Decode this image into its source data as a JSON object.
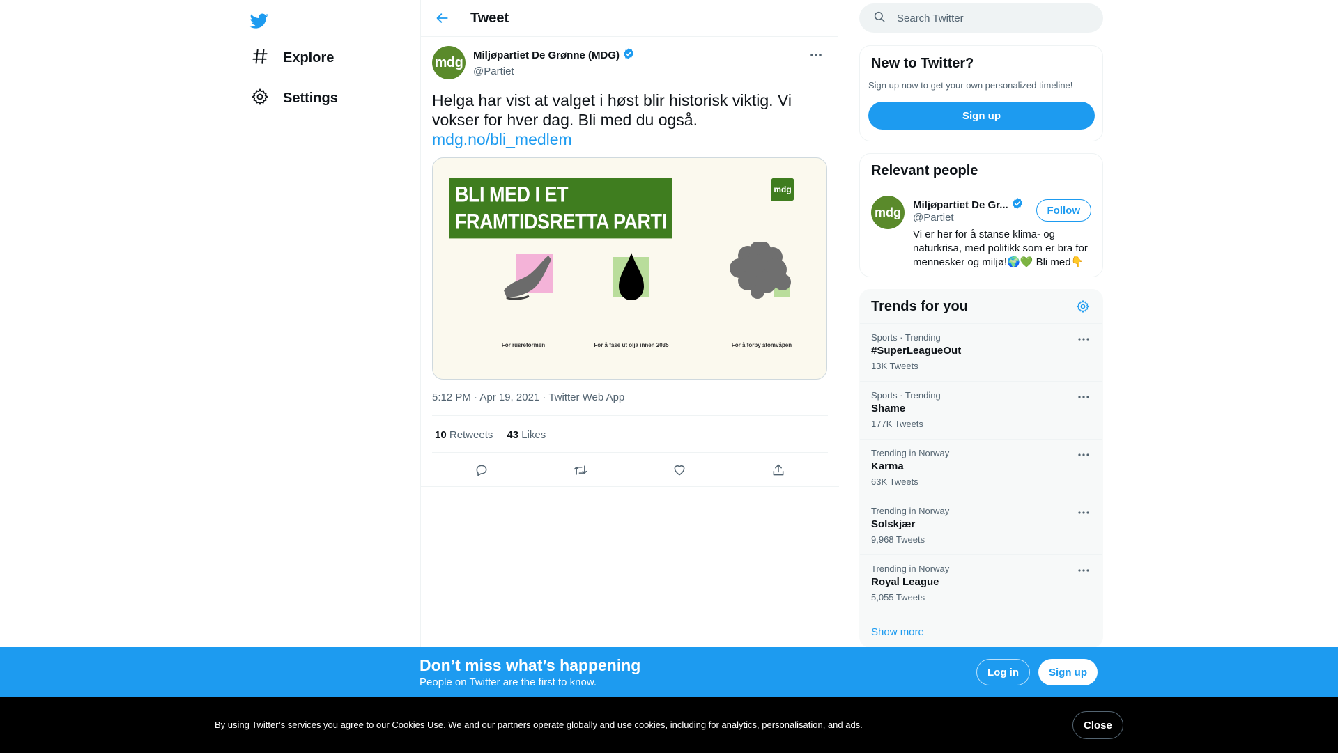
{
  "nav": {
    "logo_icon": "twitter-bird-icon",
    "items": [
      {
        "label": "Explore",
        "icon": "hashtag-icon"
      },
      {
        "label": "Settings",
        "icon": "gear-icon"
      }
    ]
  },
  "main": {
    "header_title": "Tweet",
    "tweet": {
      "author_name": "Miljøpartiet De Grønne (MDG)",
      "author_handle": "@Partiet",
      "avatar_text": "mdg",
      "text": "Helga har vist at valget i høst blir historisk viktig. Vi vokser for hver dag. Bli med du også.",
      "link": "mdg.no/bli_medlem",
      "media": {
        "banner_line1": "BLI MED I ET",
        "banner_line2": "FRAMTIDSRETTA PARTI",
        "badge": "mdg",
        "captions": [
          "For rusreformen",
          "For å fase ut olja innen 2035",
          "For å forby atomvåpen"
        ]
      },
      "timestamp": "5:12 PM · Apr 19, 2021 · Twitter Web App",
      "retweets_count": "10",
      "retweets_label": "Retweets",
      "likes_count": "43",
      "likes_label": "Likes"
    }
  },
  "right": {
    "search_placeholder": "Search Twitter",
    "new_to_twitter": {
      "title": "New to Twitter?",
      "subtitle": "Sign up now to get your own personalized timeline!",
      "signup_label": "Sign up"
    },
    "relevant_people": {
      "title": "Relevant people",
      "name": "Miljøpartiet De Gr...",
      "handle": "@Partiet",
      "avatar_text": "mdg",
      "follow_label": "Follow",
      "bio": "Vi er her for å stanse klima- og naturkrisa, med politikk som er bra for mennesker og miljø!🌍💚 Bli med👇"
    },
    "trends": {
      "title": "Trends for you",
      "items": [
        {
          "context": "Sports · Trending",
          "name": "#SuperLeagueOut",
          "count": "13K Tweets"
        },
        {
          "context": "Sports · Trending",
          "name": "Shame",
          "count": "177K Tweets"
        },
        {
          "context": "Trending in Norway",
          "name": "Karma",
          "count": "63K Tweets"
        },
        {
          "context": "Trending in Norway",
          "name": "Solskjær",
          "count": "9,968 Tweets"
        },
        {
          "context": "Trending in Norway",
          "name": "Royal League",
          "count": "5,055 Tweets"
        }
      ],
      "show_more": "Show more"
    }
  },
  "bottom_bar": {
    "title": "Don’t miss what’s happening",
    "subtitle": "People on Twitter are the first to know.",
    "login_label": "Log in",
    "signup_label": "Sign up"
  },
  "cookie_bar": {
    "text_before": "By using Twitter’s services you agree to our ",
    "link_text": "Cookies Use",
    "text_after": ". We and our partners operate globally and use cookies, including for analytics, personalisation, and ads.",
    "close_label": "Close"
  },
  "colors": {
    "accent": "#1d9bf0",
    "mdg_green": "#3f7d1f",
    "text": "#0f1419",
    "muted": "#536471"
  }
}
